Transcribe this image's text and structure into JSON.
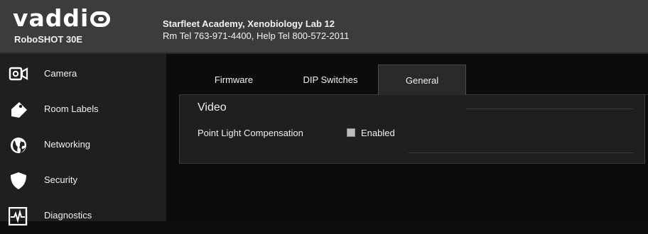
{
  "brand": {
    "logo_text": "vaddi",
    "model": "RoboSHOT 30E"
  },
  "site": {
    "line1": "Starfleet Academy, Xenobiology Lab 12",
    "line2": "Rm Tel 763-971-4400, Help Tel 800-572-2011"
  },
  "sidebar": {
    "items": [
      {
        "label": "Camera",
        "icon": "camera-icon"
      },
      {
        "label": "Room Labels",
        "icon": "tag-icon"
      },
      {
        "label": "Networking",
        "icon": "globe-icon"
      },
      {
        "label": "Security",
        "icon": "shield-icon"
      },
      {
        "label": "Diagnostics",
        "icon": "pulse-icon"
      }
    ]
  },
  "tabs": [
    {
      "label": "Firmware",
      "active": false
    },
    {
      "label": "DIP Switches",
      "active": false
    },
    {
      "label": "General",
      "active": true
    }
  ],
  "panel": {
    "section_title": "Video",
    "field_label": "Point Light Compensation",
    "checkbox_label": "Enabled",
    "checkbox_checked": false
  },
  "colors": {
    "header_bg": "#3c3c3c",
    "sidebar_bg": "#1f1f1f",
    "main_bg": "#0c0c0c",
    "panel_bg": "#1f1f1f"
  }
}
